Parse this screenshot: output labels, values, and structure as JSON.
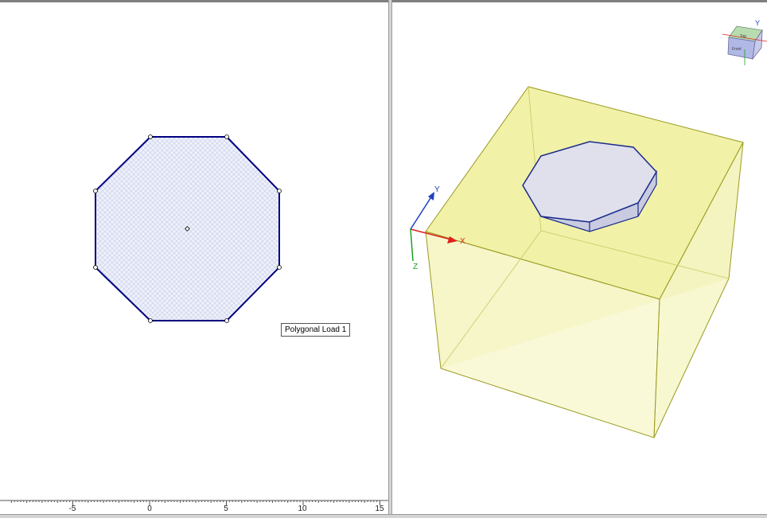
{
  "plan_view": {
    "shape_label": "Polygonal Load 1",
    "ruler_ticks": [
      "-5",
      "0",
      "5",
      "10",
      "15"
    ],
    "colors": {
      "outline": "#00007f",
      "fill": "#e8ecf8",
      "hatch": "#c4cce8"
    }
  },
  "view_3d": {
    "axes": {
      "x": "X",
      "y": "Y",
      "z": "Z"
    },
    "view_cube": {
      "top_face": "Top",
      "front_face": "Front",
      "axis_label": "Y"
    },
    "colors": {
      "box_fill": "#f3f3b8",
      "box_edge": "#9a9a20",
      "load_fill": "#dfe0ec",
      "load_edge": "#1a2a8a"
    }
  }
}
